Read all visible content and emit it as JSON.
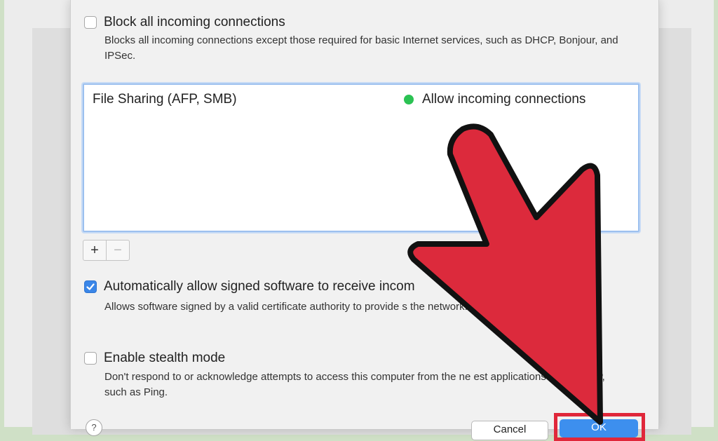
{
  "firewall_options": {
    "block_all": {
      "label": "Block all incoming connections",
      "checked": false,
      "description": "Blocks all incoming connections except those required for basic Internet services,  such as DHCP, Bonjour, and IPSec."
    },
    "services_list": [
      {
        "name": "File Sharing (AFP, SMB)",
        "status": "Allow incoming connections",
        "status_color": "#2bc253"
      }
    ],
    "list_controls": {
      "add": "+",
      "remove": "−"
    },
    "auto_allow_signed": {
      "label": "Automatically allow signed software to receive incom",
      "checked": true,
      "description": "Allows software signed by a valid certificate authority to provide s                                    the network."
    },
    "stealth_mode": {
      "label": "Enable stealth mode",
      "checked": false,
      "description": "Don't respond to or acknowledge attempts to access this computer from the ne                        est applications using ICMP, such as Ping."
    }
  },
  "footer": {
    "help": "?",
    "cancel_label": "Cancel",
    "ok_label": "OK"
  },
  "colors": {
    "accent": "#3d8fee",
    "highlight_arrow": "#dc2a3c",
    "highlight_frame": "#e0273a"
  }
}
